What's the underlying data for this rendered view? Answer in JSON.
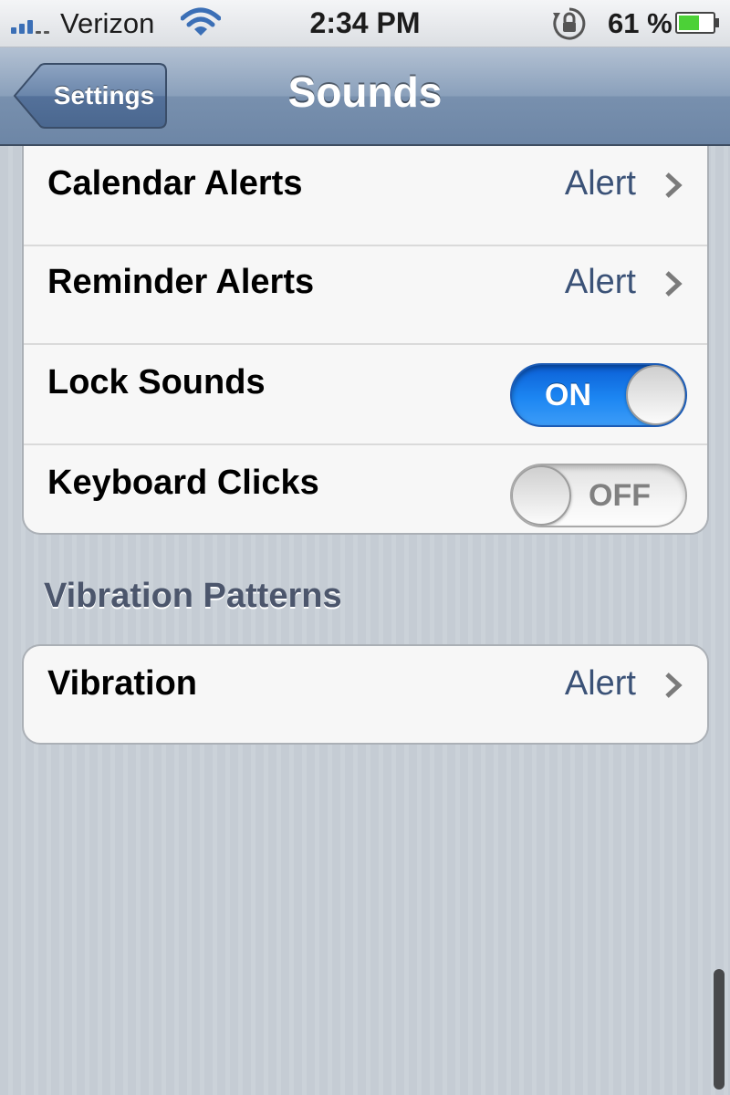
{
  "status_bar": {
    "carrier": "Verizon",
    "time": "2:34 PM",
    "battery_percent": "61 %",
    "battery_level": 0.61,
    "icons": [
      "signal-icon",
      "wifi-icon",
      "rotation-lock-icon",
      "battery-icon"
    ]
  },
  "nav": {
    "back_label": "Settings",
    "title": "Sounds"
  },
  "alerts": {
    "calendar": {
      "label": "Calendar Alerts",
      "value": "Alert"
    },
    "reminder": {
      "label": "Reminder Alerts",
      "value": "Alert"
    }
  },
  "toggles": {
    "lock_sounds": {
      "label": "Lock Sounds",
      "state": "ON"
    },
    "keyboard_clicks": {
      "label": "Keyboard Clicks",
      "state": "OFF"
    }
  },
  "vibration_section": {
    "header": "Vibration Patterns",
    "vibration": {
      "label": "Vibration",
      "value": "Alert"
    }
  },
  "colors": {
    "accent_blue": "#1c86f2",
    "value_text": "#3b5277",
    "nav_bar": "#7890ae"
  }
}
